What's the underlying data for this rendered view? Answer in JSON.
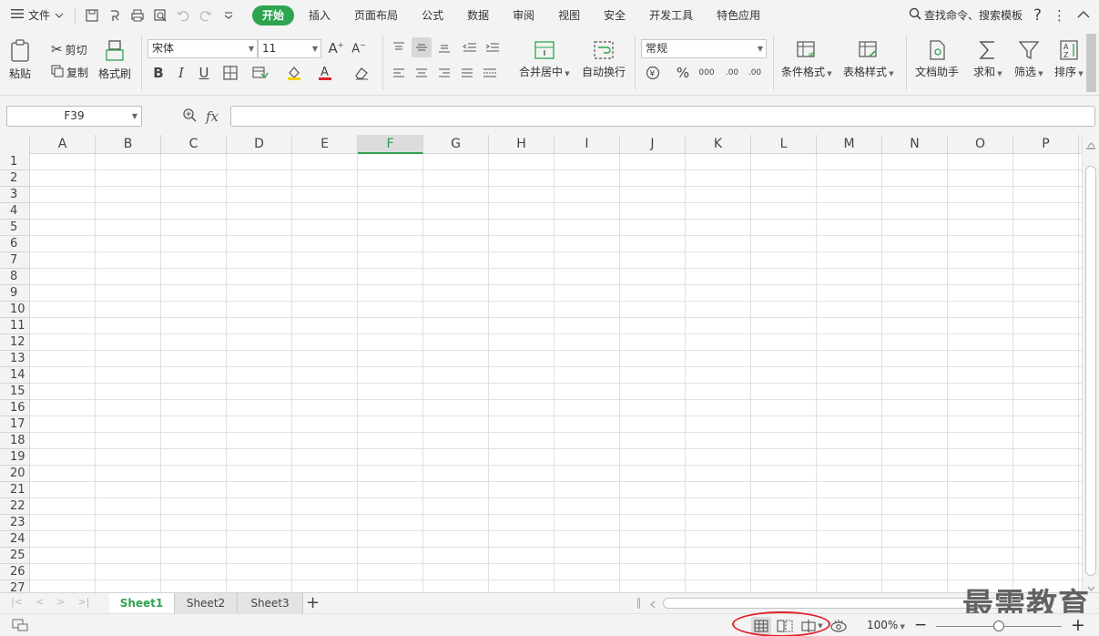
{
  "menubar": {
    "file_label": "文件",
    "tabs": [
      {
        "label": "开始",
        "active": true
      },
      {
        "label": "插入"
      },
      {
        "label": "页面布局"
      },
      {
        "label": "公式"
      },
      {
        "label": "数据"
      },
      {
        "label": "审阅"
      },
      {
        "label": "视图"
      },
      {
        "label": "安全"
      },
      {
        "label": "开发工具"
      },
      {
        "label": "特色应用"
      }
    ],
    "search_label": "查找命令、搜索模板",
    "help": "?",
    "more": "⋮",
    "collapse": "^"
  },
  "ribbon": {
    "paste": "粘贴",
    "cut": "剪切",
    "copy": "复制",
    "format_painter": "格式刷",
    "font_name": "宋体",
    "font_size": "11",
    "bold": "B",
    "italic": "I",
    "underline": "U",
    "merge_center": "合并居中",
    "wrap_text": "自动换行",
    "number_format": "常规",
    "percent": "%",
    "thousands": "000",
    "inc_decimal": ".00",
    "dec_decimal": ".00",
    "conditional_format": "条件格式",
    "table_style": "表格样式",
    "doc_assistant": "文档助手",
    "sum": "求和",
    "filter": "筛选",
    "sort": "排序"
  },
  "formula_bar": {
    "name_box": "F39",
    "fx": "fx",
    "formula": ""
  },
  "grid": {
    "columns": [
      "A",
      "B",
      "C",
      "D",
      "E",
      "F",
      "G",
      "H",
      "I",
      "J",
      "K",
      "L",
      "M",
      "N",
      "O",
      "P"
    ],
    "selected_column": "F",
    "rows": [
      "1",
      "2",
      "3",
      "4",
      "5",
      "6",
      "7",
      "8",
      "9",
      "10",
      "11",
      "12",
      "13",
      "14",
      "15",
      "16",
      "17",
      "18",
      "19",
      "20",
      "21",
      "22",
      "23",
      "24",
      "25",
      "26",
      "27"
    ]
  },
  "sheets": [
    {
      "label": "Sheet1",
      "active": true
    },
    {
      "label": "Sheet2"
    },
    {
      "label": "Sheet3"
    }
  ],
  "add_sheet": "+",
  "watermark": "最需教育",
  "status": {
    "zoom_label": "100%",
    "zoom_level_percent": 100,
    "zoom_minus": "−",
    "zoom_plus": "+"
  },
  "colors": {
    "accent": "#2ea44f",
    "highlight_oval": "#e0242b"
  }
}
